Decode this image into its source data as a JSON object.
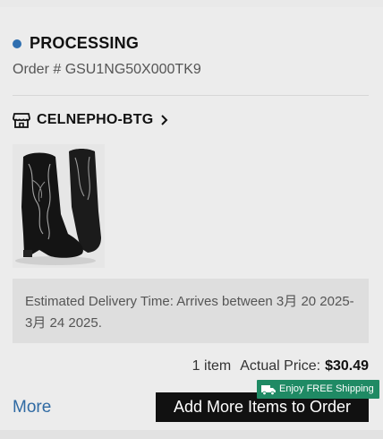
{
  "order": {
    "status": "PROCESSING",
    "status_color": "#2f6fb0",
    "order_number": "Order # GSU1NG50X000TK9"
  },
  "store": {
    "icon": "store-icon",
    "name": "CELNEPHO-BTG",
    "chevron": "chevron-right-icon"
  },
  "product": {
    "image_alt": "black western boots"
  },
  "delivery": {
    "text": "Estimated Delivery Time: Arrives between 3月 20 2025-3月 24 2025."
  },
  "summary": {
    "item_count": "1 item",
    "price_label": "Actual Price:",
    "price": "$30.49"
  },
  "actions": {
    "more_label": "More",
    "add_more_label": "Add More Items to Order",
    "shipping_badge": "Enjoy FREE Shipping",
    "shipping_badge_color": "#1f8a64"
  }
}
